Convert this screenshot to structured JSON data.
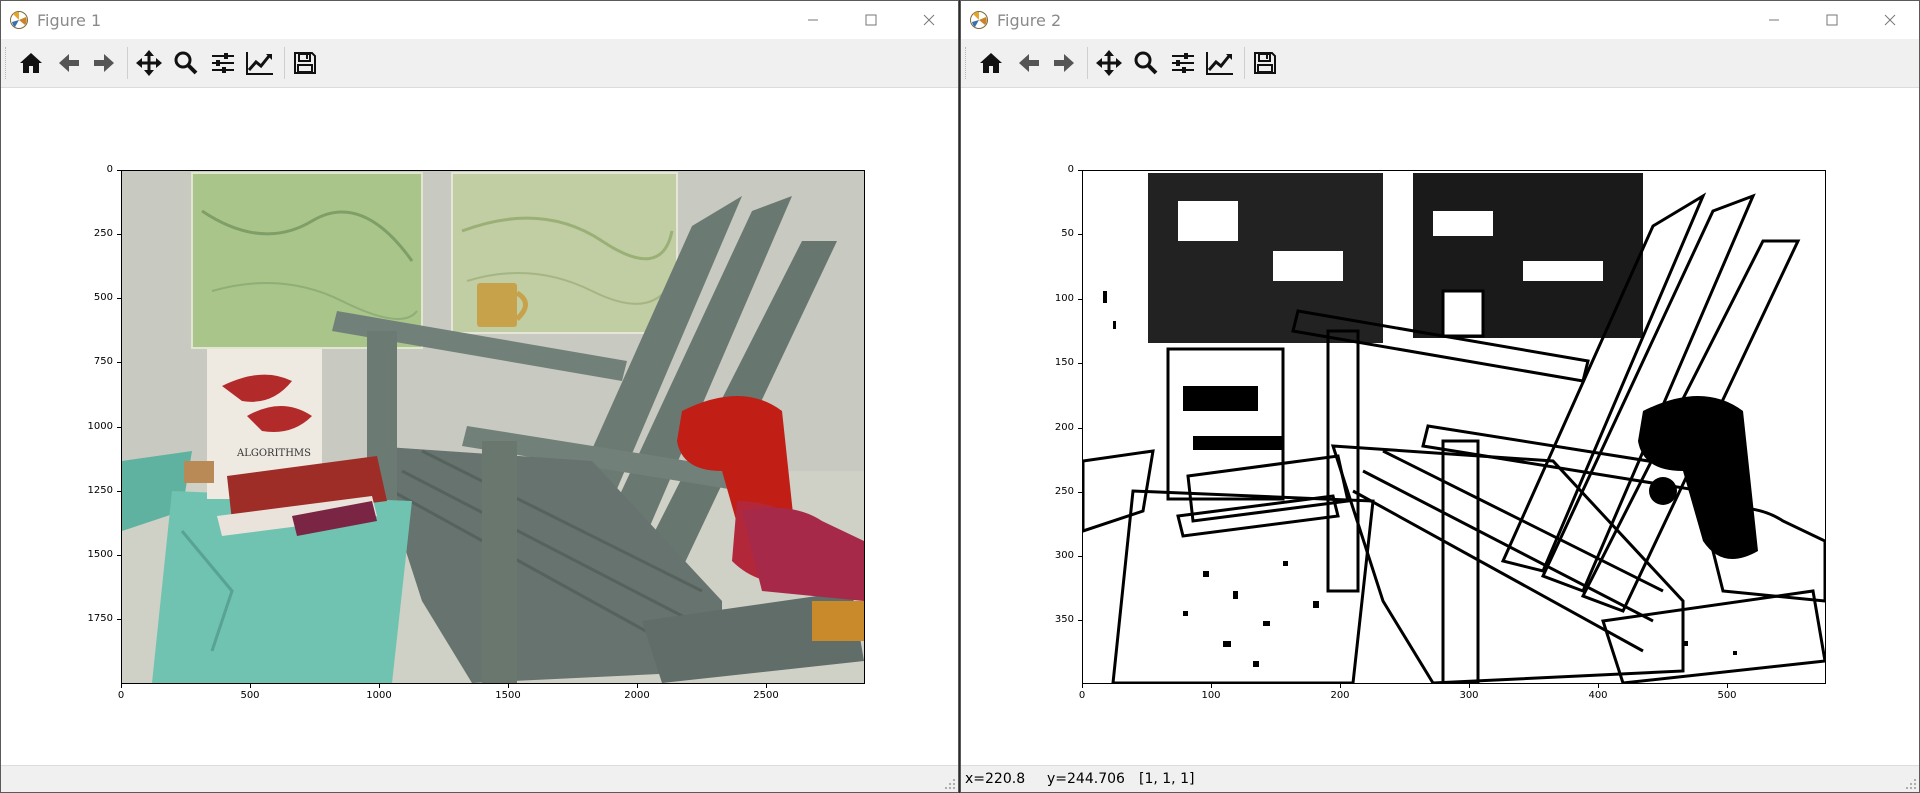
{
  "windows": [
    {
      "title": "Figure 1",
      "toolbar": [
        "home-icon",
        "back-icon",
        "forward-icon",
        "pan-icon",
        "zoom-icon",
        "configure-subplots-icon",
        "edit-axes-icon",
        "save-icon"
      ],
      "yticks": [
        "0",
        "250",
        "500",
        "750",
        "1000",
        "1250",
        "1500",
        "1750"
      ],
      "xticks": [
        "0",
        "500",
        "1000",
        "1500",
        "2000",
        "2500"
      ],
      "status": {
        "x": "",
        "y": "",
        "value": ""
      }
    },
    {
      "title": "Figure 2",
      "toolbar": [
        "home-icon",
        "back-icon",
        "forward-icon",
        "pan-icon",
        "zoom-icon",
        "configure-subplots-icon",
        "edit-axes-icon",
        "save-icon"
      ],
      "yticks": [
        "0",
        "50",
        "100",
        "150",
        "200",
        "250",
        "300",
        "350"
      ],
      "xticks": [
        "0",
        "100",
        "200",
        "300",
        "400",
        "500"
      ],
      "status": {
        "x": "x=220.8",
        "y": "y=244.706",
        "value": "[1, 1, 1]"
      }
    }
  ],
  "colors": {
    "title_inactive": "#8a8a8a",
    "toolbar_bg": "#f0f0f0",
    "canvas_bg": "#ffffff"
  }
}
